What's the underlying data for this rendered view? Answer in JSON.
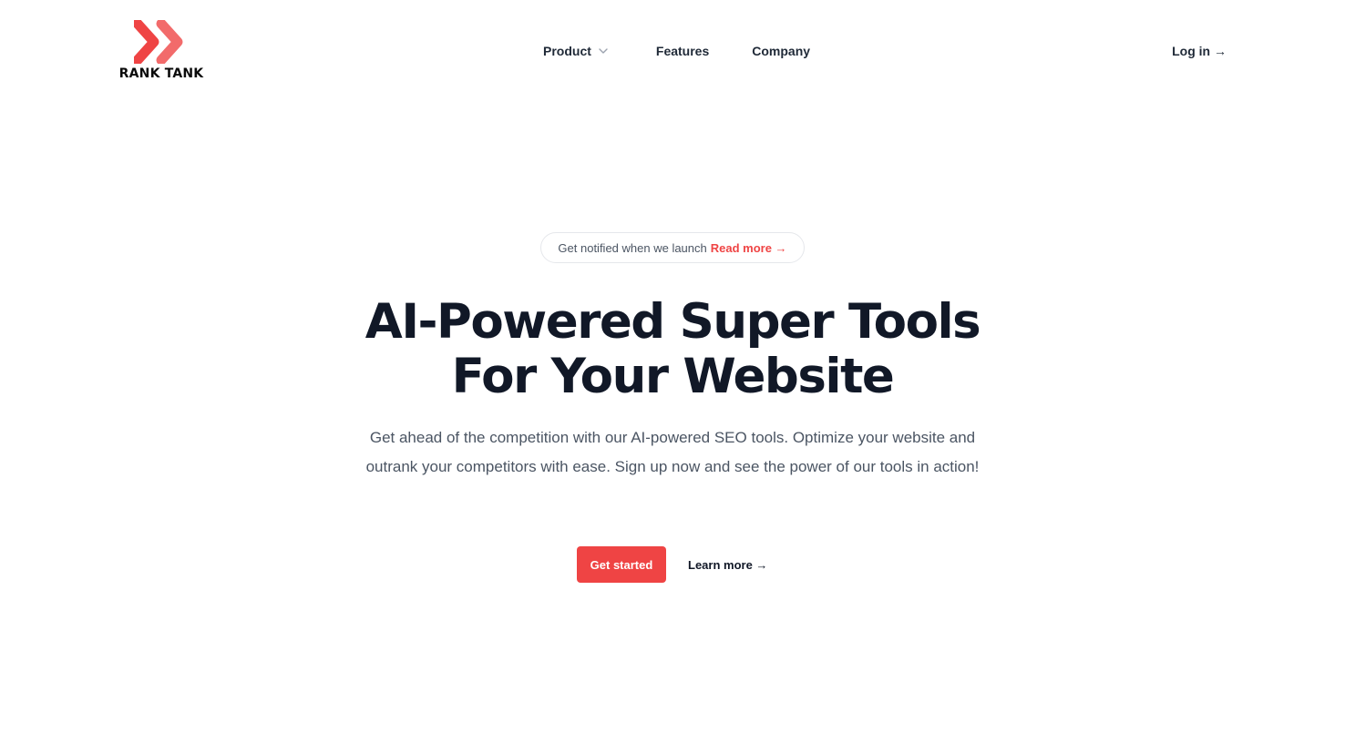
{
  "brand": {
    "name": "RANK TANK",
    "logo_icon": "double-chevron-right-icon",
    "accent_color": "#ef4444"
  },
  "nav": {
    "items": [
      {
        "label": "Product",
        "icon": "chevron-down-icon"
      },
      {
        "label": "Features"
      },
      {
        "label": "Company"
      }
    ],
    "login_label": "Log in →"
  },
  "hero": {
    "announcement": {
      "text": "Get notified when we launch",
      "link_label": "Read more →"
    },
    "headline_line1": "AI-Powered Super Tools",
    "headline_line2": "For Your Website",
    "subheading": "Get ahead of the competition with our AI-powered SEO tools. Optimize your website and outrank your competitors with ease. Sign up now and see the power of our tools in action!",
    "primary_cta": "Get started",
    "secondary_cta": "Learn more →"
  }
}
